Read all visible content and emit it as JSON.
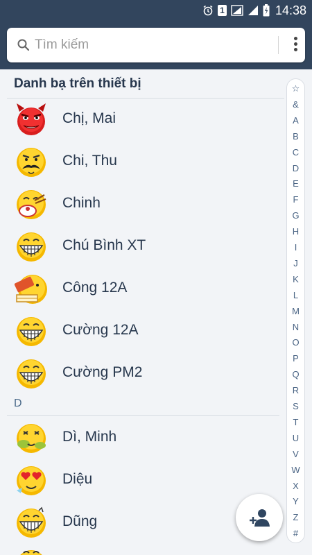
{
  "status_bar": {
    "time": "14:38",
    "sim_label": "1"
  },
  "search": {
    "placeholder": "Tìm kiếm"
  },
  "section_title": "Danh bạ trên thiết bị",
  "section_d_label": "D",
  "contacts": [
    {
      "name": "Chị, Mai",
      "avatar": "devil-emoji"
    },
    {
      "name": "Chi, Thu",
      "avatar": "mustache-emoji"
    },
    {
      "name": "Chinh",
      "avatar": "eating-emoji"
    },
    {
      "name": "Chú Bình XT",
      "avatar": "grin-emoji"
    },
    {
      "name": "Công 12A",
      "avatar": "book-emoji"
    },
    {
      "name": "Cường 12A",
      "avatar": "grin-emoji"
    },
    {
      "name": "Cường PM2",
      "avatar": "grin-emoji"
    },
    {
      "name": "Dì, Minh",
      "avatar": "sick-emoji"
    },
    {
      "name": "Diệu",
      "avatar": "heart-eyes-emoji"
    },
    {
      "name": "Dũng",
      "avatar": "grin-emoji"
    }
  ],
  "index_letters": [
    "☆",
    "&",
    "A",
    "B",
    "C",
    "D",
    "E",
    "F",
    "G",
    "H",
    "I",
    "J",
    "K",
    "L",
    "M",
    "N",
    "O",
    "P",
    "Q",
    "R",
    "S",
    "T",
    "U",
    "V",
    "W",
    "X",
    "Y",
    "Z",
    "#"
  ],
  "colors": {
    "header": "#32455d",
    "background": "#f2f4f7",
    "accent": "#27374d"
  }
}
